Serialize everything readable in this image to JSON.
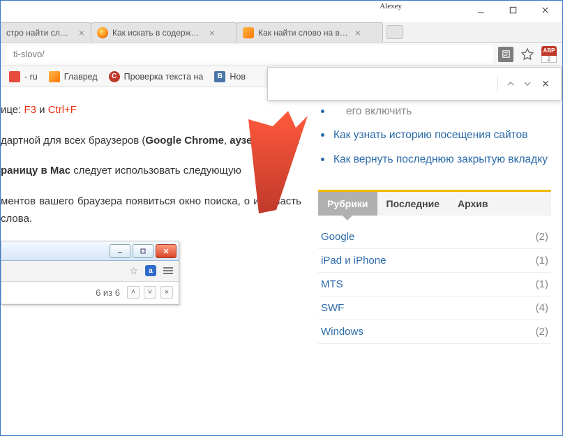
{
  "titlebar": {
    "user": "Alexey"
  },
  "tabs": [
    {
      "title": "стро найти сло…"
    },
    {
      "title": "Как искать в содержи…"
    },
    {
      "title": "Как найти слово на ве…"
    }
  ],
  "address": {
    "url": "ti-slovo/"
  },
  "abp": {
    "label": "ABP",
    "count": "2"
  },
  "bookmarks": [
    {
      "label": "- ru"
    },
    {
      "label": "Главред"
    },
    {
      "label": "Проверка текста на"
    },
    {
      "label": "Нов"
    }
  ],
  "findbar": {
    "placeholder": ""
  },
  "article": {
    "line1_a": "ице: ",
    "line1_b": "F3",
    "line1_c": " и ",
    "line1_d": "Ctrl+F",
    "p2_a": "дартной для всех браузеров (",
    "p2_b": "Google Chrome",
    "p2_c": ", ",
    "p2_d": "аузер, Safari",
    "p2_e": ").",
    "p3_a": "раницу в Mac",
    "p3_b": " следует использовать следующую",
    "p4": "ментов вашего браузера появиться окно поиска, о или часть слова."
  },
  "mini": {
    "a": "a",
    "count": "6 из 6"
  },
  "sidebar_top_cut": "его включить",
  "sidebar_links": [
    "Как узнать историю посещения сайтов",
    "Как вернуть последнюю закрытую вкладку"
  ],
  "tabs_widget": {
    "t1": "Рубрики",
    "t2": "Последние",
    "t3": "Архив"
  },
  "categories": [
    {
      "name": "Google",
      "count": "(2)"
    },
    {
      "name": "iPad и iPhone",
      "count": "(1)"
    },
    {
      "name": "MTS",
      "count": "(1)"
    },
    {
      "name": "SWF",
      "count": "(4)"
    },
    {
      "name": "Windows",
      "count": "(2)"
    }
  ]
}
